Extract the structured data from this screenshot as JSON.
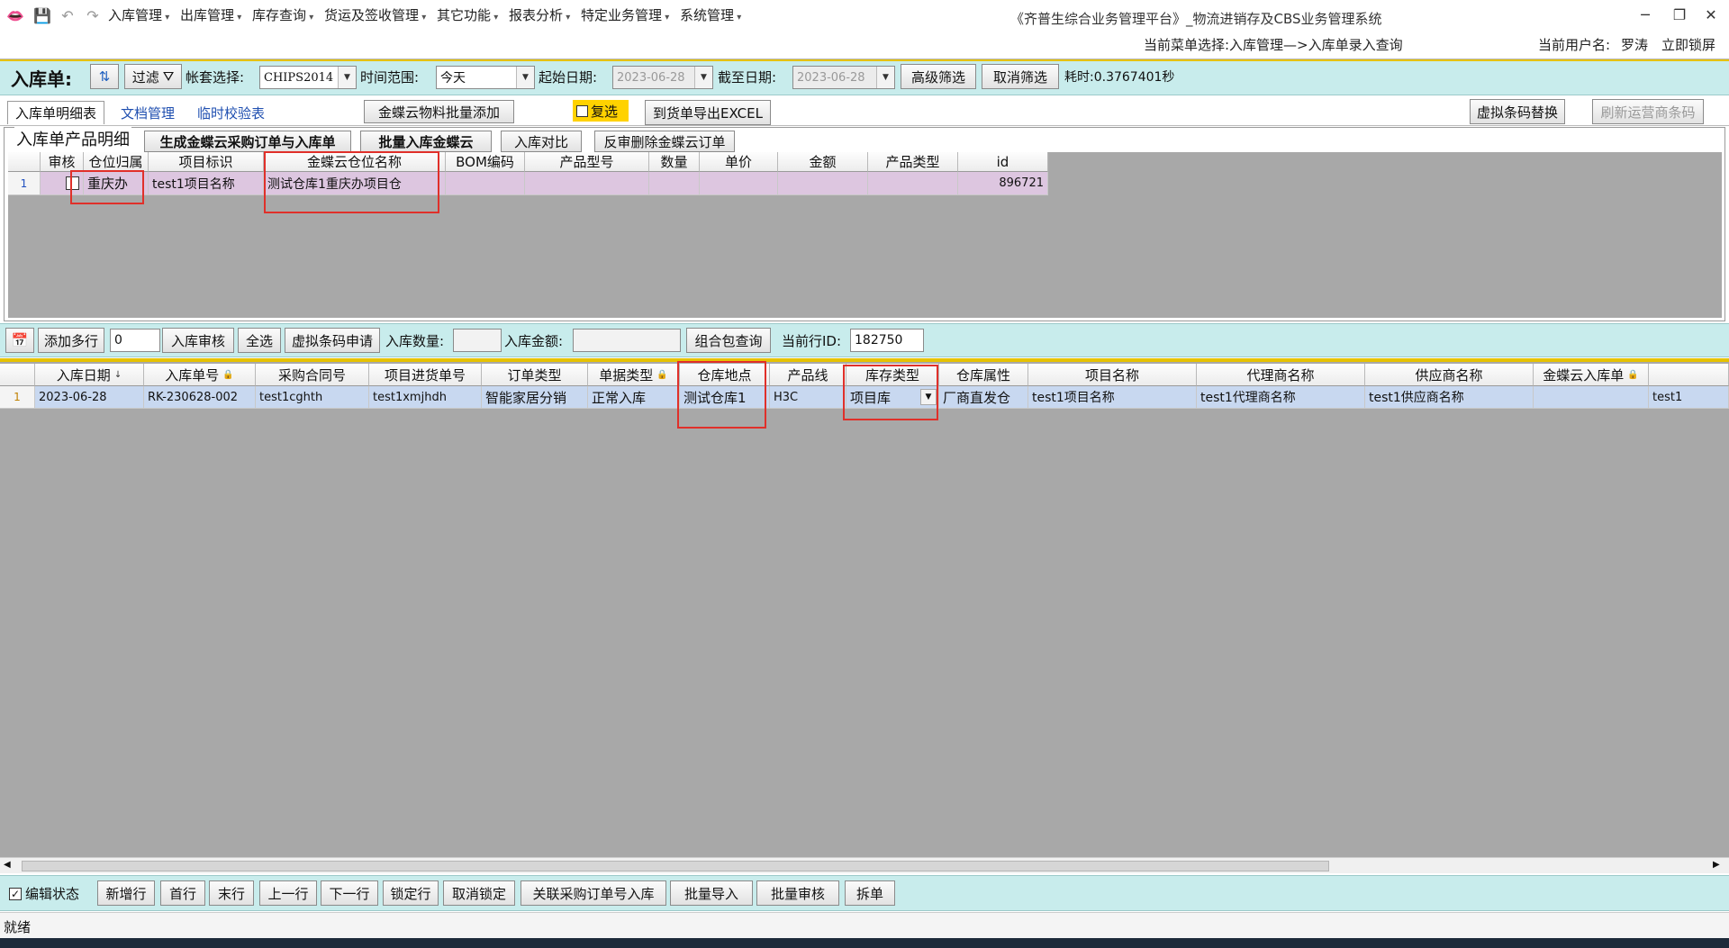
{
  "app": {
    "title": "《齐普生综合业务管理平台》_物流进销存及CBS业务管理系统",
    "current_menu": "当前菜单选择:入库管理—>入库单录入查询",
    "user_label": "当前用户名:",
    "user_name": "罗涛",
    "lock_label": "立即锁屏"
  },
  "menu": [
    "入库管理",
    "出库管理",
    "库存查询",
    "货运及签收管理",
    "其它功能",
    "报表分析",
    "特定业务管理",
    "系统管理"
  ],
  "filter_bar": {
    "form_title": "入库单:",
    "filter_label": "过滤",
    "account_label": "帐套选择:",
    "account_value": "CHIPS2014",
    "range_label": "时间范围:",
    "range_value": "今天",
    "start_label": "起始日期:",
    "start_value": "2023-06-28",
    "end_label": "截至日期:",
    "end_value": "2023-06-28",
    "advanced_button": "高级筛选",
    "cancel_filter_button": "取消筛选",
    "elapsed": "耗时:0.3767401秒"
  },
  "tabs_bar": {
    "tabs": [
      "入库单明细表",
      "文档管理",
      "临时校验表"
    ],
    "batch_add_button": "金蝶云物料批量添加",
    "multi_select_label": "复选",
    "export_button": "到货单导出EXCEL",
    "virtual_replace_button": "虚拟条码替换",
    "refresh_carrier_button": "刷新运营商条码"
  },
  "detail_panel": {
    "group_title": "入库单产品明细",
    "buttons": [
      "生成金蝶云采购订单与入库单",
      "批量入库金蝶云",
      "入库对比",
      "反审删除金蝶云订单"
    ],
    "columns": [
      "审核",
      "仓位归属",
      "项目标识",
      "金蝶云仓位名称",
      "BOM编码",
      "产品型号",
      "数量",
      "单价",
      "金额",
      "产品类型",
      "id"
    ],
    "rows": [
      {
        "num": "1",
        "audit": "",
        "location": "重庆办",
        "project_id": "test1项目名称",
        "kd_location": "测试仓库1重庆办项目仓",
        "bom": "",
        "model": "",
        "qty": "",
        "price": "",
        "amount": "",
        "ptype": "",
        "id": "896721"
      }
    ]
  },
  "action_bar": {
    "add_rows_button": "添加多行",
    "add_rows_value": "0",
    "audit_button": "入库审核",
    "select_all_button": "全选",
    "virtual_barcode_button": "虚拟条码申请",
    "qty_label": "入库数量:",
    "amount_label": "入库金额:",
    "combo_query_button": "组合包查询",
    "current_row_label": "当前行ID:",
    "current_row_value": "182750"
  },
  "main_grid": {
    "columns": [
      "入库日期",
      "入库单号",
      "采购合同号",
      "项目进货单号",
      "订单类型",
      "单据类型",
      "仓库地点",
      "产品线",
      "库存类型",
      "仓库属性",
      "项目名称",
      "代理商名称",
      "供应商名称",
      "金蝶云入库单",
      ""
    ],
    "rows": [
      {
        "num": "1",
        "date": "2023-06-28",
        "order_no": "RK-230628-002",
        "contract": "test1cghth",
        "project_order": "test1xmjhdh",
        "order_type": "智能家居分销",
        "doc_type": "正常入库",
        "warehouse": "测试仓库1",
        "product_line": "H3C",
        "stock_type": "项目库",
        "wh_attr": "厂商直发仓",
        "project_name": "test1项目名称",
        "agent": "test1代理商名称",
        "supplier": "test1供应商名称",
        "kd_inbound": "",
        "extra": "test1"
      }
    ]
  },
  "bottom_bar": {
    "edit_state_label": "编辑状态",
    "buttons": [
      "新增行",
      "首行",
      "末行",
      "上一行",
      "下一行",
      "锁定行",
      "取消锁定",
      "关联采购订单号入库",
      "批量导入",
      "批量审核",
      "拆单"
    ]
  },
  "status": "就绪",
  "colors": {
    "accent_band": "#c8ecec",
    "highlight": "#e0302a",
    "selected_row": "#c8d8f0",
    "detail_row": "#ddc6e0"
  }
}
